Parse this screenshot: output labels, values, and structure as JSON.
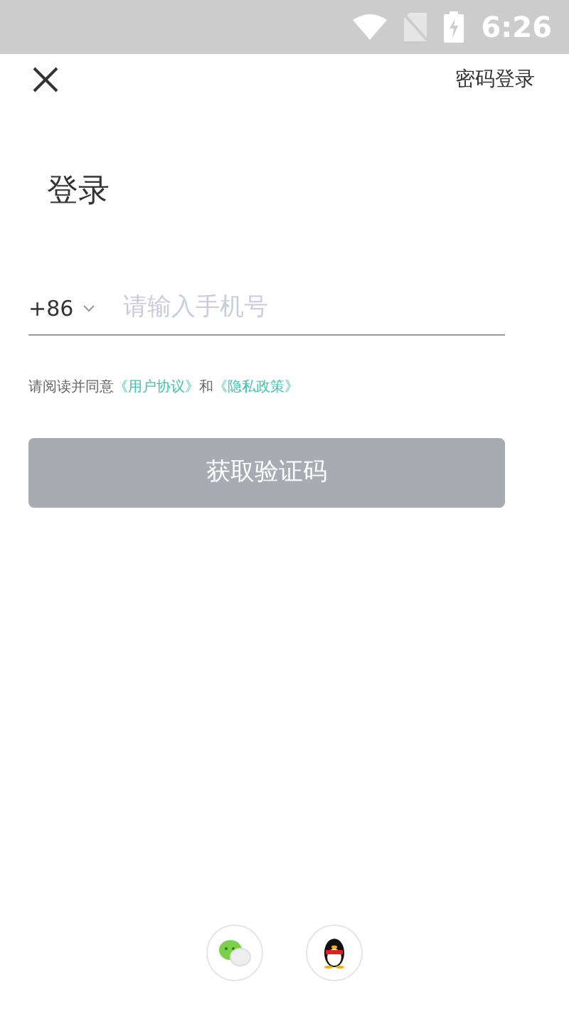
{
  "status_bar": {
    "time": "6:26"
  },
  "header": {
    "password_login": "密码登录"
  },
  "title": "登录",
  "phone_field": {
    "country_code": "+86",
    "placeholder": "请输入手机号"
  },
  "agreement": {
    "text": "请阅读并同意",
    "link_1": "《用户协议》",
    "joiner": "和",
    "link_2": "《隐私政策》"
  },
  "submit_button": {
    "label": "获取验证码",
    "disabled": true
  },
  "social_logins": [
    {
      "kind": "chat"
    },
    {
      "kind": "penguin"
    }
  ]
}
